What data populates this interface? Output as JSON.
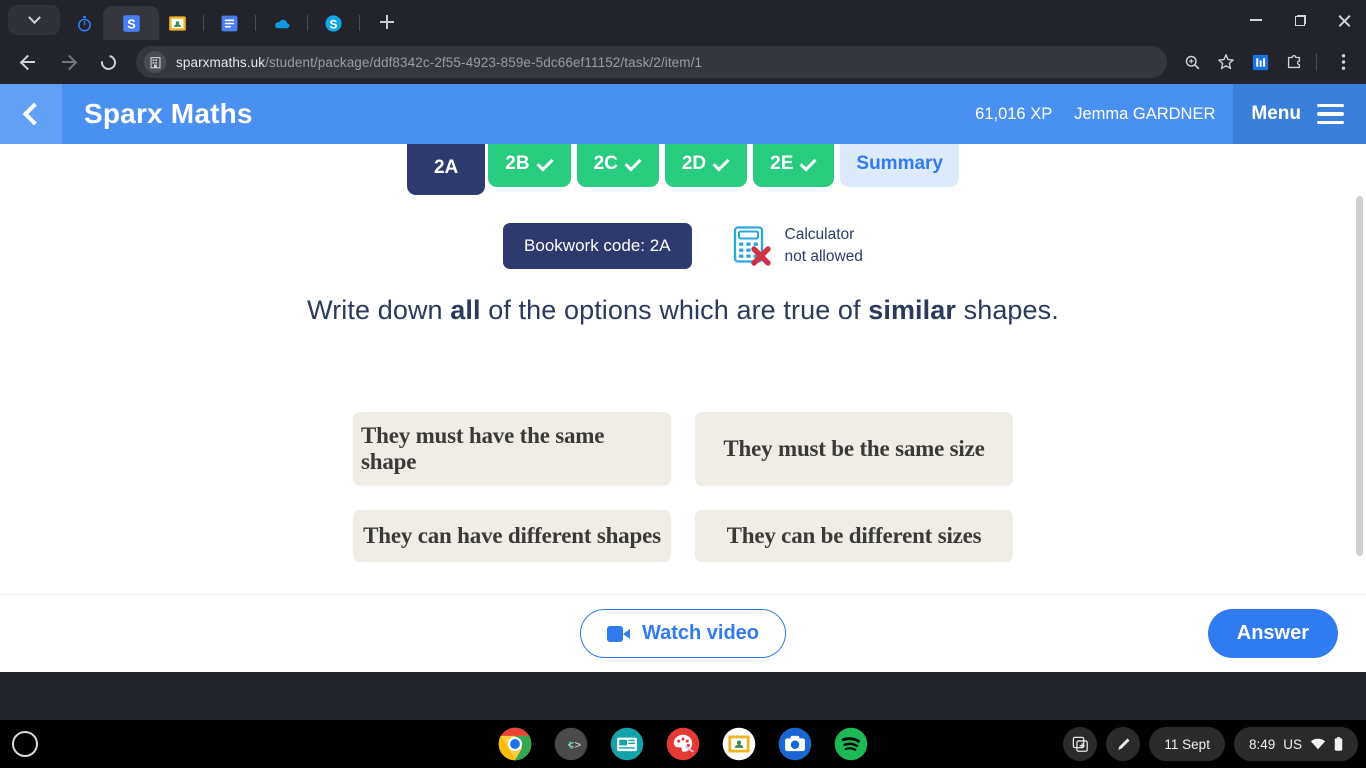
{
  "browser": {
    "tab_search_icon": "chevron-down-icon",
    "tabs": [
      {
        "icon": "stopwatch-favicon",
        "active": false
      },
      {
        "icon": "sparx-favicon",
        "active": true
      },
      {
        "icon": "google-classroom-favicon",
        "active": false
      },
      {
        "icon": "google-docs-favicon",
        "active": false
      },
      {
        "icon": "onedrive-favicon",
        "active": false
      },
      {
        "icon": "skype-favicon",
        "active": false
      }
    ],
    "new_tab_label": "+",
    "window_controls": [
      "minimize",
      "maximize",
      "close"
    ],
    "nav": {
      "back": "back-arrow",
      "forward": "forward-arrow",
      "reload": "reload-icon"
    },
    "url_prefix": "sparxmaths.uk",
    "url_path": "/student/package/ddf8342c-2f55-4923-859e-5dc66ef11152/task/2/item/1",
    "toolbar_icons": [
      "zoom-icon",
      "bookmark-star-icon",
      "extension-blue-icon",
      "extensions-puzzle-icon",
      "kebab-menu-icon"
    ]
  },
  "sparx": {
    "back_icon": "back-chevron-icon",
    "title": "Sparx Maths",
    "xp": "61,016 XP",
    "user": "Jemma GARDNER",
    "menu_label": "Menu",
    "menu_icon": "hamburger-icon",
    "colors": {
      "header": "#4a90f0",
      "header_back_panel": "#62a0f5",
      "menu_panel": "#3a7fdc",
      "navy": "#2e3a6e",
      "green": "#27cc7e",
      "blue": "#2f7bef",
      "option_bg": "#f0ede7"
    }
  },
  "question_tabs": [
    {
      "label": "2A",
      "state": "active",
      "check": ""
    },
    {
      "label": "2B",
      "state": "done",
      "check": "check-icon"
    },
    {
      "label": "2C",
      "state": "done",
      "check": "check-icon"
    },
    {
      "label": "2D",
      "state": "done",
      "check": "check-icon"
    },
    {
      "label": "2E",
      "state": "done",
      "check": "check-icon"
    },
    {
      "label": "Summary",
      "state": "summary",
      "check": ""
    }
  ],
  "meta": {
    "bookwork_label": "Bookwork code: 2A",
    "calculator_icon": "calculator-not-allowed-icon",
    "calculator_line1": "Calculator",
    "calculator_line2": "not allowed"
  },
  "question": {
    "part1": "Write down ",
    "bold1": "all",
    "part2": " of the options which are true of ",
    "bold2": "similar",
    "part3": " shapes."
  },
  "options": [
    {
      "label": "They must have the same shape"
    },
    {
      "label": "They must be the same size"
    },
    {
      "label": "They can have different shapes"
    },
    {
      "label": "They can be different sizes"
    }
  ],
  "footer": {
    "watch_video_label": "Watch video",
    "watch_video_icon": "video-camera-icon",
    "answer_label": "Answer"
  },
  "shelf": {
    "launcher_icon": "launcher-circle-icon",
    "apps": [
      {
        "name": "chrome-app-icon",
        "running": true
      },
      {
        "name": "typing-club-app-icon",
        "running": false
      },
      {
        "name": "news-app-icon",
        "running": false
      },
      {
        "name": "paint-app-icon",
        "running": false
      },
      {
        "name": "google-classroom-app-icon",
        "running": true
      },
      {
        "name": "camera-app-icon",
        "running": false
      },
      {
        "name": "spotify-app-icon",
        "running": true
      }
    ],
    "tray": {
      "capture_icon": "screen-capture-icon",
      "stylus_icon": "stylus-pen-icon",
      "date": "11 Sept",
      "time": "8:49",
      "locale": "US",
      "wifi_icon": "wifi-icon",
      "battery_icon": "battery-icon"
    }
  }
}
